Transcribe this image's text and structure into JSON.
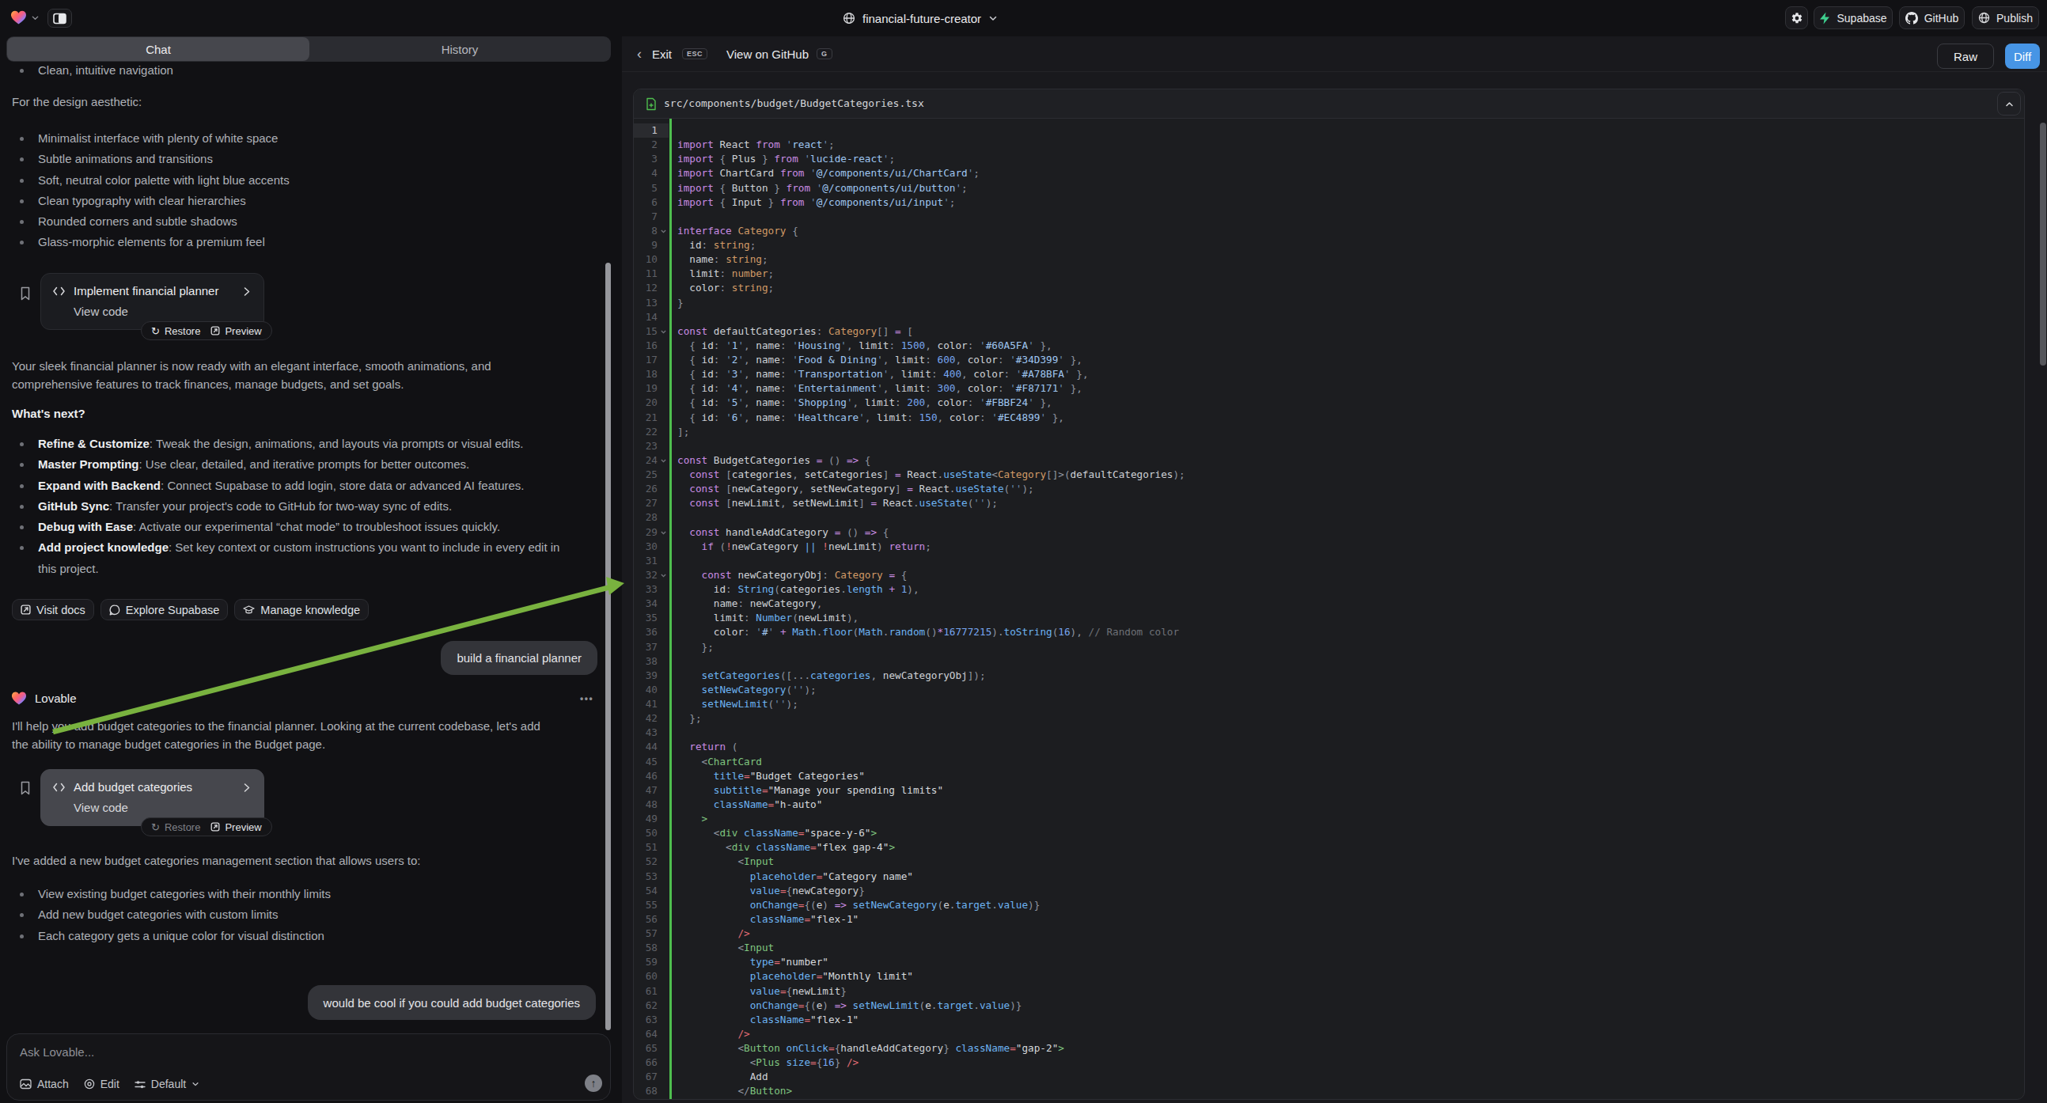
{
  "topbar": {
    "project_name": "financial-future-creator",
    "supabase": "Supabase",
    "github": "GitHub",
    "publish": "Publish"
  },
  "tabs": {
    "chat": "Chat",
    "history": "History"
  },
  "chat": {
    "intro_bullet": "Clean, intuitive navigation",
    "design_para": "For the design aesthetic:",
    "design_bullets": [
      "Minimalist interface with plenty of white space",
      "Subtle animations and transitions",
      "Soft, neutral color palette with light blue accents",
      "Clean typography with clear hierarchies",
      "Rounded corners and subtle shadows",
      "Glass-morphic elements for a premium feel"
    ],
    "card1": {
      "title": "Implement financial planner",
      "subtitle": "View code",
      "restore": "Restore",
      "preview": "Preview"
    },
    "ready_para": "Your sleek financial planner is now ready with an elegant interface, smooth animations, and comprehensive features to track finances, manage budgets, and set goals.",
    "whats_next": "What's next?",
    "next_bullets": [
      {
        "lead": "Refine & Customize",
        "text": ": Tweak the design, animations, and layouts via prompts or visual edits."
      },
      {
        "lead": "Master Prompting",
        "text": ": Use clear, detailed, and iterative prompts for better outcomes."
      },
      {
        "lead": "Expand with Backend",
        "text": ": Connect Supabase to add login, store data or advanced AI features."
      },
      {
        "lead": "GitHub Sync",
        "text": ": Transfer your project's code to GitHub for two-way sync of edits."
      },
      {
        "lead": "Debug with Ease",
        "text": ": Activate our experimental “chat mode” to troubleshoot issues quickly."
      },
      {
        "lead": "Add project knowledge",
        "text": ": Set key context or custom instructions you want to include in every edit in this project."
      }
    ],
    "action_buttons": [
      "Visit docs",
      "Explore Supabase",
      "Manage knowledge"
    ],
    "user_msg1": "build a financial planner",
    "assistant_name": "Lovable",
    "help_para": "I'll help you add budget categories to the financial planner. Looking at the current codebase, let's add the ability to manage budget categories in the Budget page.",
    "card2": {
      "title": "Add budget categories",
      "subtitle": "View code",
      "restore": "Restore",
      "preview": "Preview"
    },
    "added_para": "I've added a new budget categories management section that allows users to:",
    "added_bullets": [
      "View existing budget categories with their monthly limits",
      "Add new budget categories with custom limits",
      "Each category gets a unique color for visual distinction"
    ],
    "user_msg2": "would be cool if you could add budget categories",
    "input": {
      "placeholder": "Ask Lovable...",
      "attach": "Attach",
      "edit": "Edit",
      "mode": "Default"
    }
  },
  "codepanel": {
    "exit": "Exit",
    "esc": "ESC",
    "view_on_github": "View on GitHub",
    "g_key": "G",
    "raw": "Raw",
    "diff": "Diff",
    "file_path": "src/components/budget/BudgetCategories.tsx",
    "fold_lines": [
      8,
      15,
      24,
      29,
      32
    ],
    "code_lines": [
      "",
      "import React from 'react';",
      "import { Plus } from 'lucide-react';",
      "import ChartCard from '@/components/ui/ChartCard';",
      "import { Button } from '@/components/ui/button';",
      "import { Input } from '@/components/ui/input';",
      "",
      "interface Category {",
      "  id: string;",
      "  name: string;",
      "  limit: number;",
      "  color: string;",
      "}",
      "",
      "const defaultCategories: Category[] = [",
      "  { id: '1', name: 'Housing', limit: 1500, color: '#60A5FA' },",
      "  { id: '2', name: 'Food & Dining', limit: 600, color: '#34D399' },",
      "  { id: '3', name: 'Transportation', limit: 400, color: '#A78BFA' },",
      "  { id: '4', name: 'Entertainment', limit: 300, color: '#F87171' },",
      "  { id: '5', name: 'Shopping', limit: 200, color: '#FBBF24' },",
      "  { id: '6', name: 'Healthcare', limit: 150, color: '#EC4899' },",
      "];",
      "",
      "const BudgetCategories = () => {",
      "  const [categories, setCategories] = React.useState<Category[]>(defaultCategories);",
      "  const [newCategory, setNewCategory] = React.useState('');",
      "  const [newLimit, setNewLimit] = React.useState('');",
      "",
      "  const handleAddCategory = () => {",
      "    if (!newCategory || !newLimit) return;",
      "",
      "    const newCategoryObj: Category = {",
      "      id: String(categories.length + 1),",
      "      name: newCategory,",
      "      limit: Number(newLimit),",
      "      color: '#' + Math.floor(Math.random()*16777215).toString(16), // Random color",
      "    };",
      "",
      "    setCategories([...categories, newCategoryObj]);",
      "    setNewCategory('');",
      "    setNewLimit('');",
      "  };",
      "",
      "  return (",
      "    <ChartCard",
      "      title=\"Budget Categories\"",
      "      subtitle=\"Manage your spending limits\"",
      "      className=\"h-auto\"",
      "    >",
      "      <div className=\"space-y-6\">",
      "        <div className=\"flex gap-4\">",
      "          <Input",
      "            placeholder=\"Category name\"",
      "            value={newCategory}",
      "            onChange={(e) => setNewCategory(e.target.value)}",
      "            className=\"flex-1\"",
      "          />",
      "          <Input",
      "            type=\"number\"",
      "            placeholder=\"Monthly limit\"",
      "            value={newLimit}",
      "            onChange={(e) => setNewLimit(e.target.value)}",
      "            className=\"flex-1\"",
      "          />",
      "          <Button onClick={handleAddCategory} className=\"gap-2\">",
      "            <Plus size={16} />",
      "            Add",
      "          </Button>"
    ]
  }
}
